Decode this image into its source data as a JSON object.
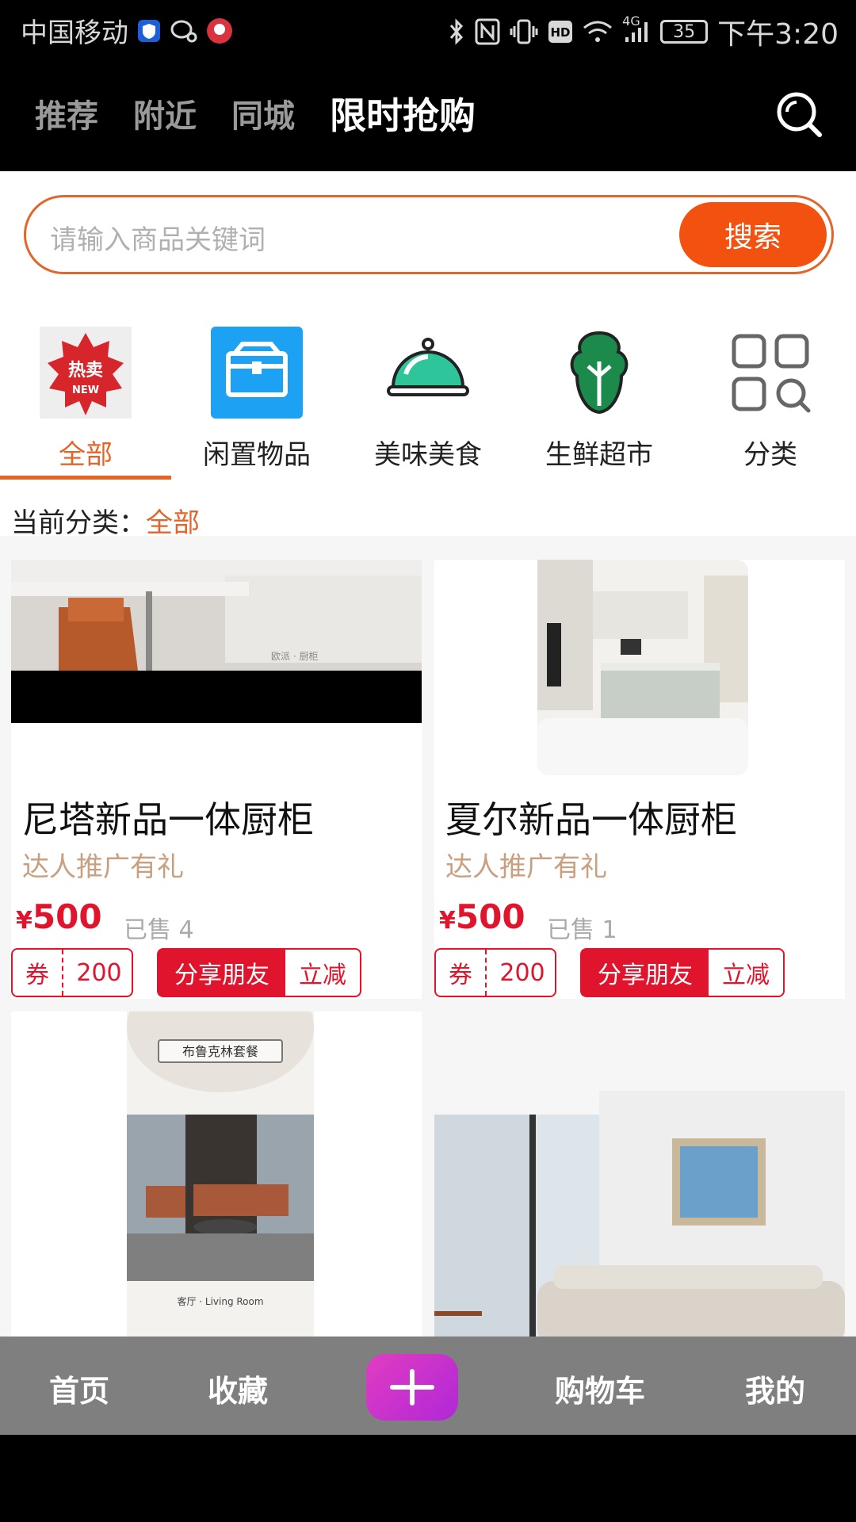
{
  "status_bar": {
    "carrier": "中国移动",
    "network": "4G",
    "battery": "35",
    "time": "下午3:20"
  },
  "top_tabs": [
    {
      "label": "推荐",
      "active": false
    },
    {
      "label": "附近",
      "active": false
    },
    {
      "label": "同城",
      "active": false
    },
    {
      "label": "限时抢购",
      "active": true
    }
  ],
  "search": {
    "placeholder": "请输入商品关键词",
    "button": "搜索"
  },
  "categories": [
    {
      "label": "全部",
      "icon": "hot-sale-new-icon",
      "active": true
    },
    {
      "label": "闲置物品",
      "icon": "box-icon",
      "active": false
    },
    {
      "label": "美味美食",
      "icon": "food-cloche-icon",
      "active": false
    },
    {
      "label": "生鲜超市",
      "icon": "cabbage-icon",
      "active": false
    },
    {
      "label": "分类",
      "icon": "grid-search-icon",
      "active": false
    }
  ],
  "hot_icon_text": {
    "top": "热卖",
    "bottom": "NEW"
  },
  "current_category": {
    "label": "当前分类：",
    "value": "全部"
  },
  "products": [
    {
      "title": "尼塔新品一体厨柜",
      "subtitle": "达人推广有礼",
      "currency": "¥",
      "price": "500",
      "sold": "已售 4",
      "coupon_label": "券",
      "coupon_value": "200",
      "share_label": "分享朋友",
      "discount_label": "立减",
      "image_caption": "欧派 · 厨柜"
    },
    {
      "title": "夏尔新品一体厨柜",
      "subtitle": "达人推广有礼",
      "currency": "¥",
      "price": "500",
      "sold": "已售 1",
      "coupon_label": "券",
      "coupon_value": "200",
      "share_label": "分享朋友",
      "discount_label": "立减"
    },
    {
      "image_label": "布鲁克林套餐",
      "image_caption": "客厅 · Living Room"
    },
    {}
  ],
  "bottom_nav": [
    {
      "label": "首页"
    },
    {
      "label": "收藏"
    },
    {
      "label": "购物车"
    },
    {
      "label": "我的"
    }
  ],
  "colors": {
    "accent": "#e3652a",
    "search_button": "#f3510f",
    "price_red": "#e0142d",
    "plus_button": "#c934cc"
  }
}
